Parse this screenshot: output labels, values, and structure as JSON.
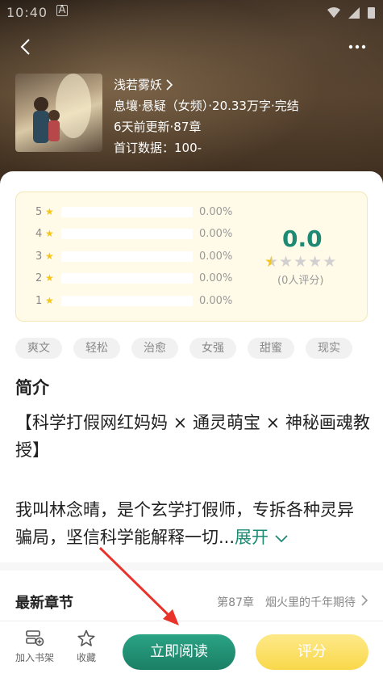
{
  "status": {
    "time": "10:40",
    "indicator": "A"
  },
  "book": {
    "author": "浅若雾妖",
    "genre_line": "息壤·悬疑（女频）·20.33万字·完结",
    "update_line": "6天前更新·87章",
    "subscribe_line": "首订数据：100-"
  },
  "rating": {
    "rows": [
      {
        "star": "5",
        "pct": "0.00%"
      },
      {
        "star": "4",
        "pct": "0.00%"
      },
      {
        "star": "3",
        "pct": "0.00%"
      },
      {
        "star": "2",
        "pct": "0.00%"
      },
      {
        "star": "1",
        "pct": "0.00%"
      }
    ],
    "score": "0.0",
    "count": "(0人评分)",
    "stars_filled_fraction": 0.5
  },
  "tags": [
    "爽文",
    "轻松",
    "治愈",
    "女强",
    "甜蜜",
    "现实"
  ],
  "intro": {
    "title": "简介",
    "line1": "【科学打假网红妈妈 × 通灵萌宝 × 神秘画魂教授】",
    "line2": "我叫林念晴，是个玄学打假师，专拆各种灵异骗局，坚信科学能解释一切...",
    "expand": "展开"
  },
  "latest": {
    "label": "最新章节",
    "chapter": "第87章　烟火里的千年期待"
  },
  "bottom": {
    "shelf_label": "加入书架",
    "fav_label": "收藏",
    "read_label": "立即阅读",
    "rate_label": "评分"
  },
  "colors": {
    "accent": "#1e8a73",
    "star": "#f5c518",
    "rate_button": "#f8d84a"
  }
}
